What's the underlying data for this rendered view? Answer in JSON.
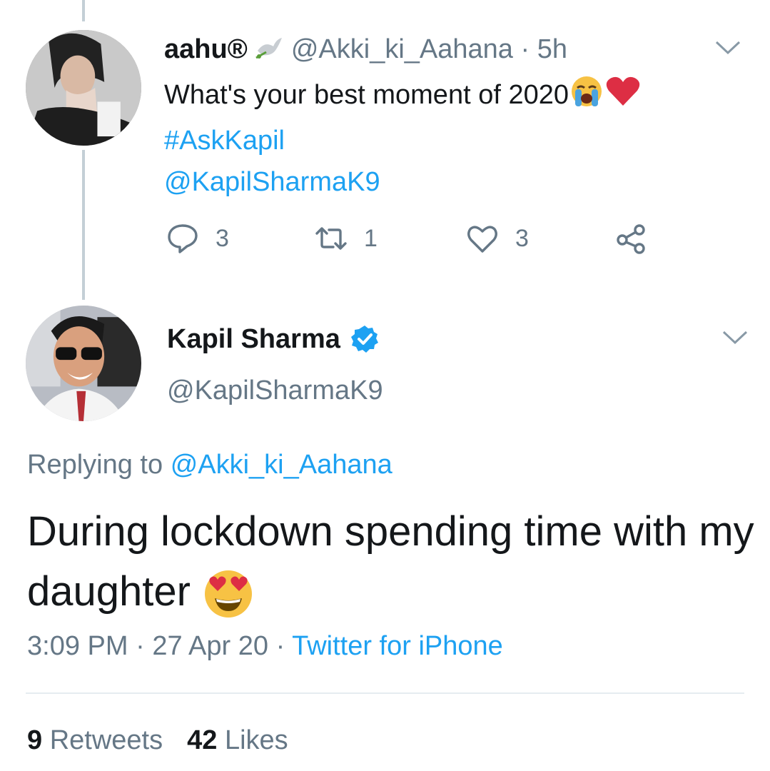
{
  "tweet1": {
    "display_name": "aahu®",
    "handle": "@Akki_ki_Aahana",
    "time_prefix": "·",
    "time": "5h",
    "text": "What's your best moment of 2020",
    "hashtag": "#AskKapil",
    "mention": "@KapilSharmaK9",
    "reply_count": "3",
    "retweet_count": "1",
    "like_count": "3",
    "icons": {
      "reply": "reply-icon",
      "retweet": "retweet-icon",
      "like": "heart-icon",
      "share": "share-icon"
    }
  },
  "tweet2": {
    "display_name": "Kapil Sharma",
    "handle": "@KapilSharmaK9",
    "replying_prefix": "Replying to",
    "replying_to": "@Akki_ki_Aahana",
    "text": "During lockdown spending time with my daughter",
    "time": "3:09 PM",
    "separator": "·",
    "date": "27 Apr 20",
    "source": "Twitter for iPhone",
    "retweets_count": "9",
    "retweets_label": "Retweets",
    "likes_count": "42",
    "likes_label": "Likes"
  },
  "colors": {
    "link": "#1da1f2",
    "muted": "#657786",
    "text": "#14171a",
    "heart": "#e0245e",
    "thread_line": "#c4cfd6"
  }
}
